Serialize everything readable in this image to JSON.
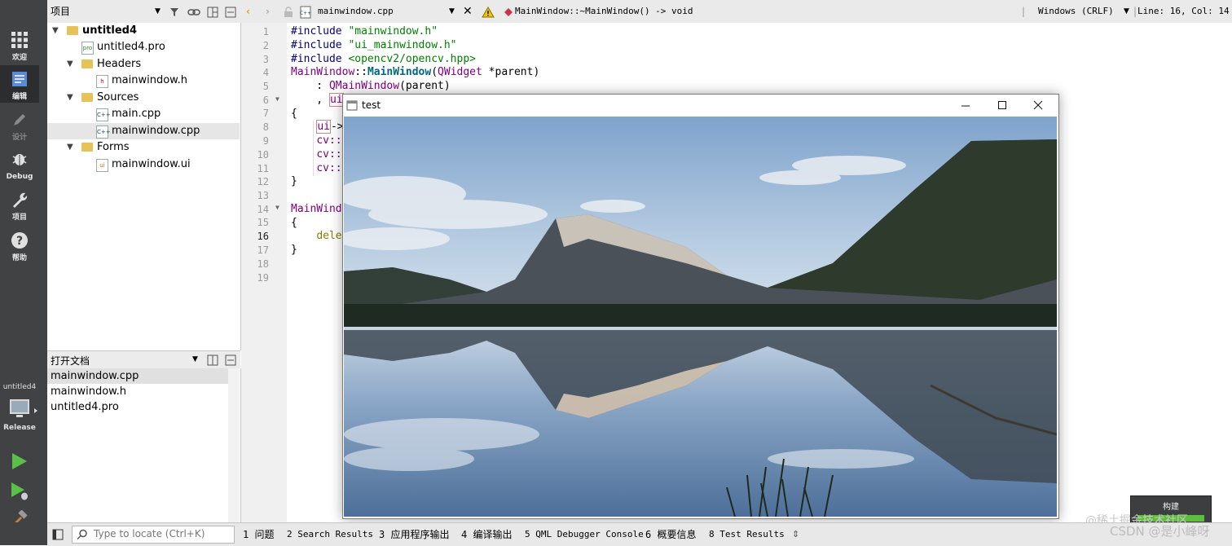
{
  "modes": [
    {
      "label": "欢迎",
      "icon": "grid-icon"
    },
    {
      "label": "编辑",
      "icon": "edit-doc-icon"
    },
    {
      "label": "设计",
      "icon": "pencil-icon"
    },
    {
      "label": "Debug",
      "icon": "bug-icon"
    },
    {
      "label": "项目",
      "icon": "wrench-icon"
    },
    {
      "label": "帮助",
      "icon": "help-icon"
    }
  ],
  "kit": {
    "project": "untitled4",
    "config": "Release"
  },
  "project_panel": {
    "title": "项目"
  },
  "tree": {
    "root": "untitled4",
    "pro_file": "untitled4.pro",
    "headers": "Headers",
    "header_file": "mainwindow.h",
    "sources": "Sources",
    "source_main": "main.cpp",
    "source_mainwindow": "mainwindow.cpp",
    "forms": "Forms",
    "form_file": "mainwindow.ui"
  },
  "open_docs": {
    "title": "打开文档",
    "items": [
      "mainwindow.cpp",
      "mainwindow.h",
      "untitled4.pro"
    ]
  },
  "editor_toolbar": {
    "file": "mainwindow.cpp",
    "symbol": "MainWindow::~MainWindow() -> void",
    "encoding": "Windows (CRLF)",
    "position": "Line: 16, Col: 14"
  },
  "line_numbers": [
    "1",
    "2",
    "3",
    "4",
    "5",
    "6",
    "7",
    "8",
    "9",
    "10",
    "11",
    "12",
    "13",
    "14",
    "15",
    "16",
    "17",
    "18",
    "19"
  ],
  "code": {
    "l1a": "#include ",
    "l1b": "\"mainwindow.h\"",
    "l2a": "#include ",
    "l2b": "\"ui_mainwindow.h\"",
    "l3a": "#include ",
    "l3b": "<opencv2/opencv.hpp>",
    "l4a": "MainWindow",
    "l4b": "::",
    "l4c": "MainWindow",
    "l4d": "(",
    "l4e": "QWidget",
    "l4f": " *parent)",
    "l5a": "    : ",
    "l5b": "QMainWindow",
    "l5c": "(parent)",
    "l6a": "    , ",
    "l6b": "ui",
    "l7": "{",
    "l8a": "    ",
    "l8b": "ui",
    "l8c": "->",
    "l9a": "    ",
    "l9b": "cv::",
    "l10a": "    ",
    "l10b": "cv::",
    "l11a": "    ",
    "l11b": "cv::",
    "l12": "}",
    "l14": "MainWind",
    "l15": "{",
    "l16a": "    ",
    "l16b": "dele",
    "l17": "}"
  },
  "window": {
    "title": "test"
  },
  "status_bar": {
    "locator_placeholder": "Type to locate (Ctrl+K)",
    "tabs": [
      "1 问题",
      "2 Search Results",
      "3 应用程序输出",
      "4 编译输出",
      "5 QML Debugger Console",
      "6 概要信息",
      "8 Test Results"
    ]
  },
  "build_popup": {
    "label": "构建"
  },
  "watermark": {
    "line1": "@稀土掘金技术社区",
    "line2": "CSDN @是小峰呀"
  }
}
